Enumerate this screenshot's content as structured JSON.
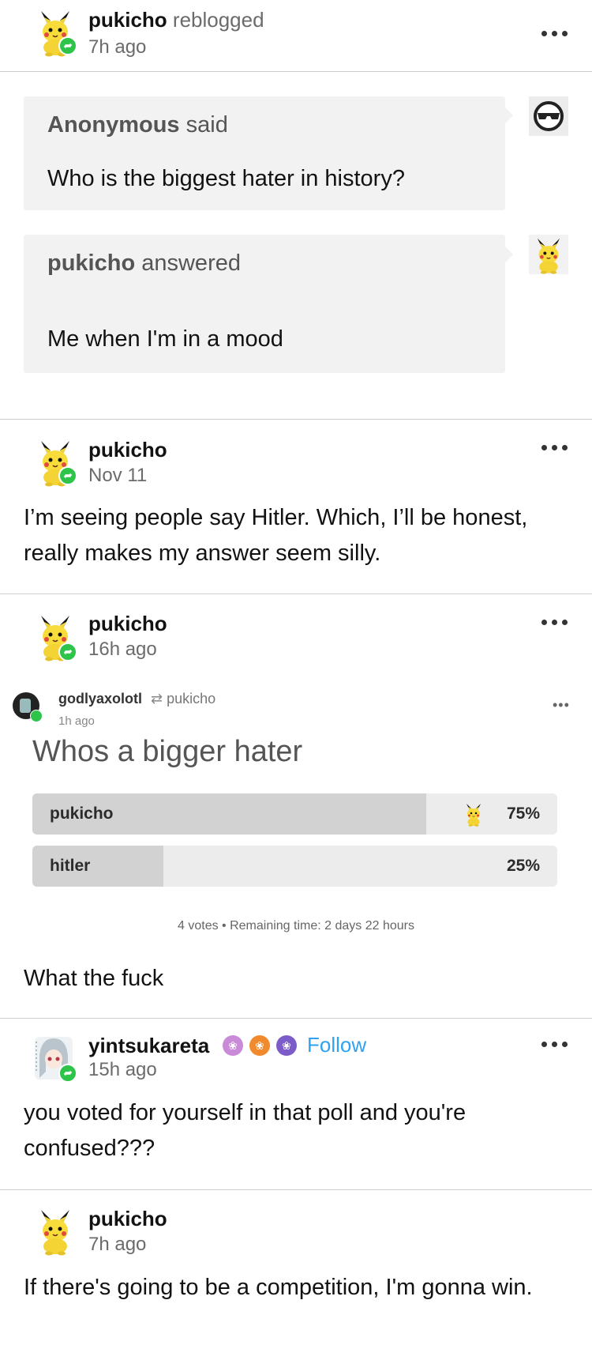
{
  "posts": {
    "reblog_header": {
      "username": "pukicho",
      "action": "reblogged",
      "time": "7h ago"
    },
    "ask": {
      "asker": "Anonymous",
      "asker_action": "said",
      "question": "Who is the biggest hater in history?"
    },
    "answer": {
      "answerer": "pukicho",
      "answerer_action": "answered",
      "text": "Me when I'm in a mood"
    },
    "post2": {
      "username": "pukicho",
      "time": "Nov 11",
      "text": "I’m seeing people say Hitler. Which, I’ll be honest, really makes my answer seem silly."
    },
    "post3": {
      "username": "pukicho",
      "time": "16h ago",
      "embed": {
        "username": "godlyaxolotl",
        "reblogged_from": "pukicho",
        "time": "1h ago",
        "question": "Whos a bigger hater",
        "options": [
          {
            "label": "pukicho",
            "percent_text": "75%",
            "percent": 75
          },
          {
            "label": "hitler",
            "percent_text": "25%",
            "percent": 25
          }
        ],
        "footer": "4 votes • Remaining time: 2 days 22 hours"
      },
      "text": "What the fuck"
    },
    "post4": {
      "username": "yintsukareta",
      "follow_label": "Follow",
      "time": "15h ago",
      "text": "you voted for yourself in that poll and you're confused???"
    },
    "post5": {
      "username": "pukicho",
      "time": "7h ago",
      "text": "If there's going to be a competition, I'm gonna win."
    }
  },
  "colors": {
    "accent_follow": "#2ea3f2",
    "reblog_green": "#2ec44a",
    "bubble_bg": "#f2f2f2"
  },
  "icons": [
    "pikachu-avatar",
    "reblog-icon",
    "more-options-icon",
    "sunglasses-avatar",
    "anime-avatar",
    "paw-badge-icon"
  ]
}
